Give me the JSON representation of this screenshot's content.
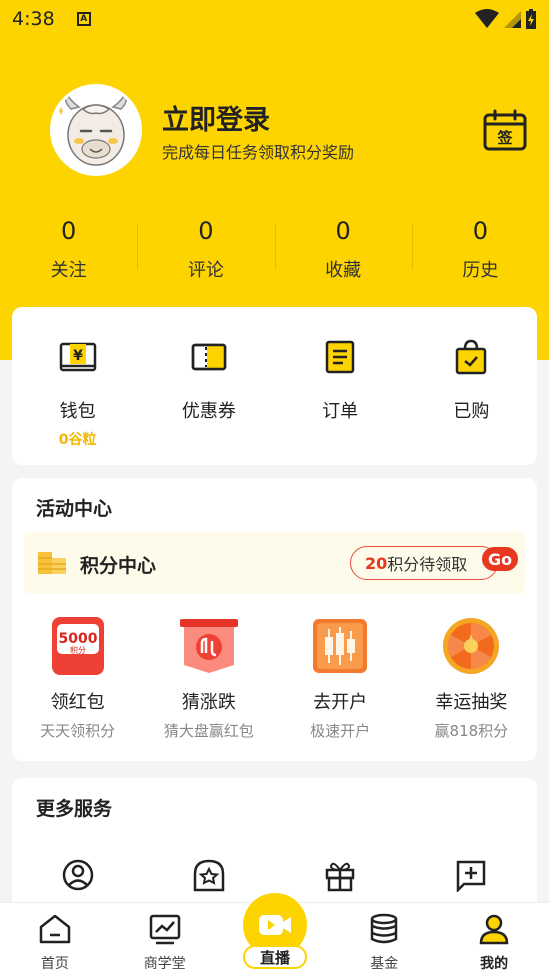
{
  "status_bar": {
    "time": "4:38",
    "notif_letter": "A"
  },
  "profile": {
    "title": "立即登录",
    "subtitle": "完成每日任务领取积分奖励",
    "sign_char": "签"
  },
  "stats": [
    {
      "value": "0",
      "label": "关注"
    },
    {
      "value": "0",
      "label": "评论"
    },
    {
      "value": "0",
      "label": "收藏"
    },
    {
      "value": "0",
      "label": "历史"
    }
  ],
  "wallet": [
    {
      "label": "钱包",
      "sub": "0谷粒",
      "icon": "wallet-icon"
    },
    {
      "label": "优惠券",
      "sub": "",
      "icon": "coupon-icon"
    },
    {
      "label": "订单",
      "sub": "",
      "icon": "order-icon"
    },
    {
      "label": "已购",
      "sub": "",
      "icon": "purchased-bag-icon"
    }
  ],
  "activity": {
    "title": "活动中心",
    "points_title": "积分中心",
    "pending_num": "20",
    "pending_text": "积分待领取",
    "go": "Go",
    "items": [
      {
        "label": "领红包",
        "sub": "天天领积分",
        "badge_top": "5000",
        "badge_bottom": "积分"
      },
      {
        "label": "猜涨跌",
        "sub": "猜大盘赢红包"
      },
      {
        "label": "去开户",
        "sub": "极速开户"
      },
      {
        "label": "幸运抽奖",
        "sub": "赢818积分"
      }
    ]
  },
  "services": {
    "title": "更多服务"
  },
  "nav": {
    "home": "首页",
    "school": "商学堂",
    "live": "直播",
    "fund": "基金",
    "mine": "我的"
  },
  "colors": {
    "brand_yellow": "#fdd400",
    "accent_red": "#e7371f",
    "points_gold": "#f5b800"
  }
}
